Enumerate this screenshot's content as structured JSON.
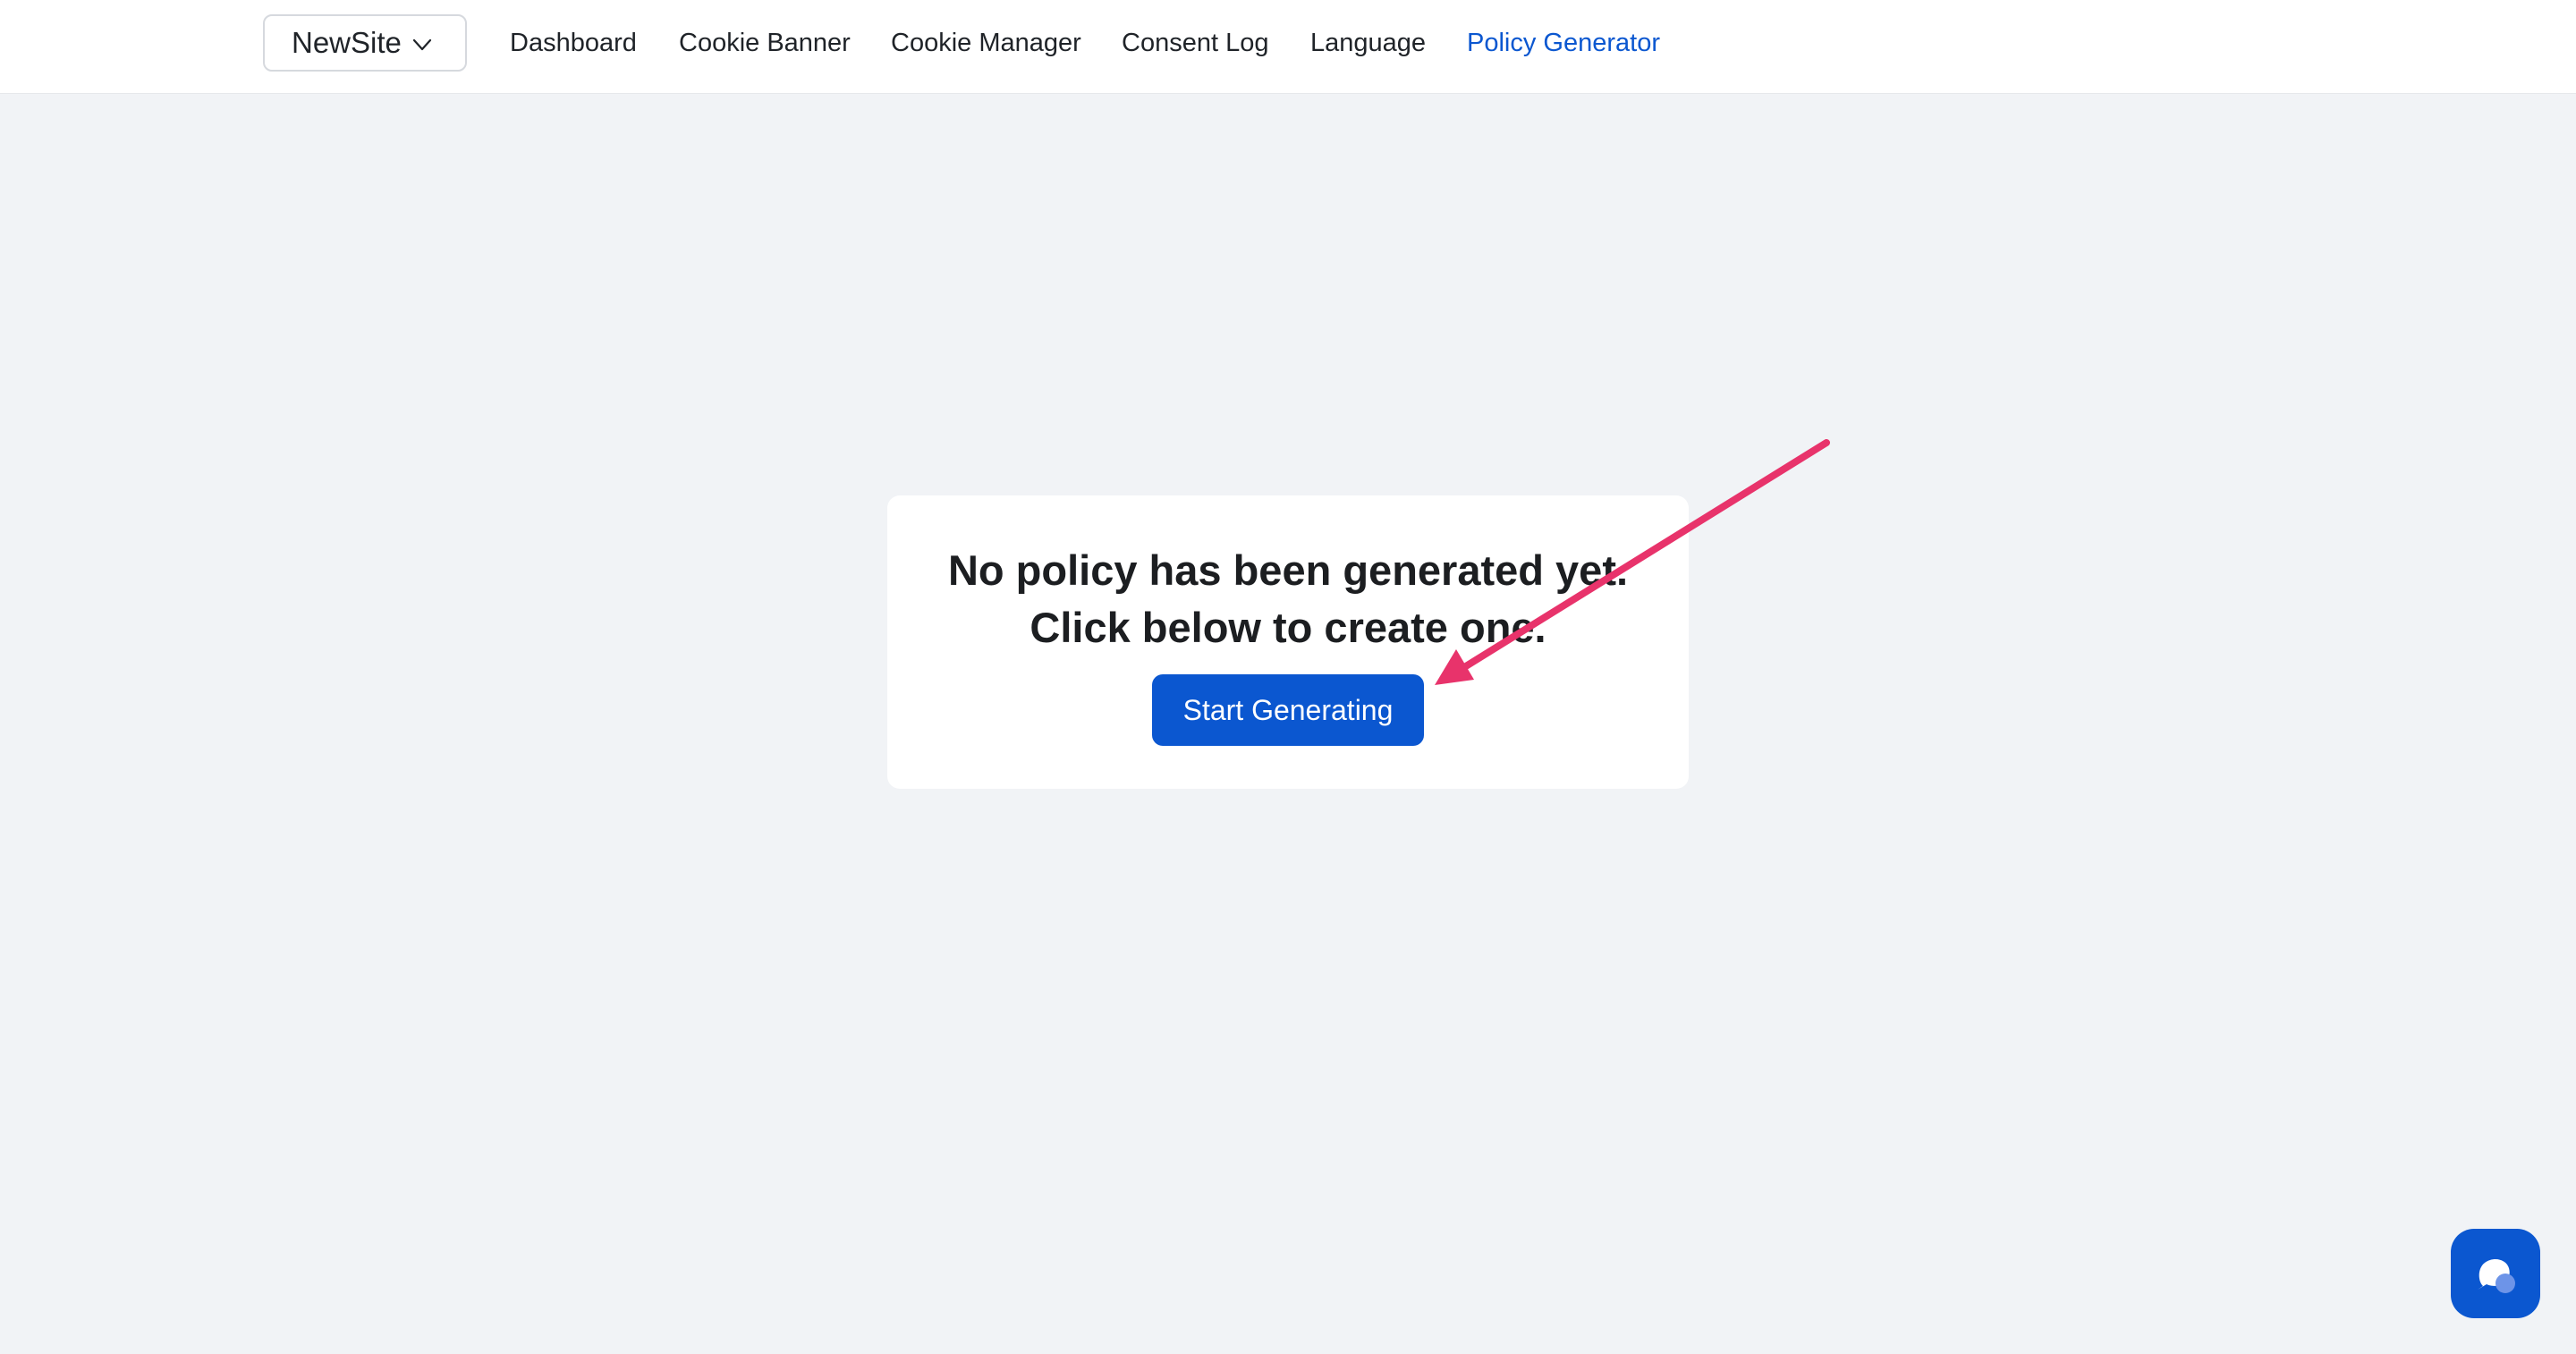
{
  "header": {
    "site_selector": {
      "label": "NewSite",
      "icon": "chevron-down-icon"
    },
    "nav": [
      {
        "id": "dashboard",
        "label": "Dashboard",
        "active": false
      },
      {
        "id": "cookie-banner",
        "label": "Cookie Banner",
        "active": false
      },
      {
        "id": "cookie-manager",
        "label": "Cookie Manager",
        "active": false
      },
      {
        "id": "consent-log",
        "label": "Consent Log",
        "active": false
      },
      {
        "id": "language",
        "label": "Language",
        "active": false
      },
      {
        "id": "policy-generator",
        "label": "Policy Generator",
        "active": true
      }
    ]
  },
  "empty_state": {
    "line1": "No policy has been generated yet.",
    "line2": "Click below to create one.",
    "button_label": "Start Generating"
  },
  "annotation": {
    "icon": "arrow-annotation",
    "color": "#e8336b"
  },
  "chat": {
    "icon": "chat-bubble-icon"
  },
  "colors": {
    "accent": "#0b57d0",
    "background": "#f1f3f6",
    "card": "#ffffff",
    "arrow": "#e8336b"
  }
}
